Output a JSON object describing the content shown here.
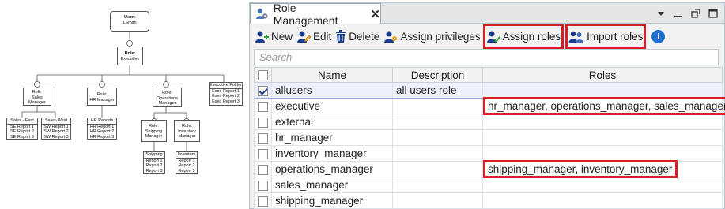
{
  "org_chart": {
    "user": {
      "label": "User:",
      "name": "LSmith"
    },
    "executive": {
      "l1": "Role:",
      "l2": "Executive"
    },
    "roles": [
      {
        "id": "sales",
        "l1": "Role:",
        "l2": "Sales",
        "l3": "Manager"
      },
      {
        "id": "hr",
        "l1": "Role:",
        "l2": "HR Manager"
      },
      {
        "id": "ops",
        "l1": "Role:",
        "l2": "Operations",
        "l3": "Manager"
      },
      {
        "id": "shipping",
        "l1": "Role:",
        "l2": "Shipping",
        "l3": "Manager"
      },
      {
        "id": "inventory",
        "l1": "Role:",
        "l2": "Inventory",
        "l3": "Manager"
      }
    ],
    "folders": {
      "sales_east": {
        "title": "Sales - East",
        "items": [
          "SE Report 1",
          "SE Report 2",
          "SE Report 3"
        ]
      },
      "sales_west": {
        "title": "Sales-West",
        "items": [
          "SW Report 1",
          "SW Report 2",
          "SW Report 3"
        ]
      },
      "hr_reports": {
        "title": "HR Reports",
        "items": [
          "HR Report 1",
          "HR Report 2",
          "HR Report 3"
        ]
      },
      "executive_folder": {
        "title": "Executive Folder",
        "items": [
          "Exec Report 1",
          "Exec Report 2",
          "Exec Report 3"
        ]
      },
      "shipping": {
        "title": "Shipping",
        "items": [
          "Report 1",
          "Report 2",
          "Report 3"
        ]
      },
      "inventory": {
        "title": "Inventory",
        "items": [
          "Report 1",
          "Report 2",
          "Report 3"
        ]
      }
    }
  },
  "panel": {
    "tab_title": "Role Management",
    "toolbar": {
      "new": "New",
      "edit": "Edit",
      "delete": "Delete",
      "assign_privileges": "Assign privileges",
      "assign_roles": "Assign roles",
      "import_roles": "Import roles"
    },
    "search_placeholder": "Search",
    "columns": {
      "name": "Name",
      "description": "Description",
      "roles": "Roles"
    },
    "rows": [
      {
        "name": "allusers",
        "description": "all users role",
        "roles": "",
        "checked": true
      },
      {
        "name": "executive",
        "description": "",
        "roles": "hr_manager, operations_manager, sales_manager",
        "checked": false
      },
      {
        "name": "external",
        "description": "",
        "roles": "",
        "checked": false
      },
      {
        "name": "hr_manager",
        "description": "",
        "roles": "",
        "checked": false
      },
      {
        "name": "inventory_manager",
        "description": "",
        "roles": "",
        "checked": false
      },
      {
        "name": "operations_manager",
        "description": "",
        "roles": "shipping_manager, inventory_manager",
        "checked": false
      },
      {
        "name": "sales_manager",
        "description": "",
        "roles": "",
        "checked": false
      },
      {
        "name": "shipping_manager",
        "description": "",
        "roles": "",
        "checked": false
      }
    ],
    "colors": {
      "highlight": "#d61f26",
      "icon_blue": "#1c3d8f",
      "accent": "#1f6fd1"
    }
  }
}
